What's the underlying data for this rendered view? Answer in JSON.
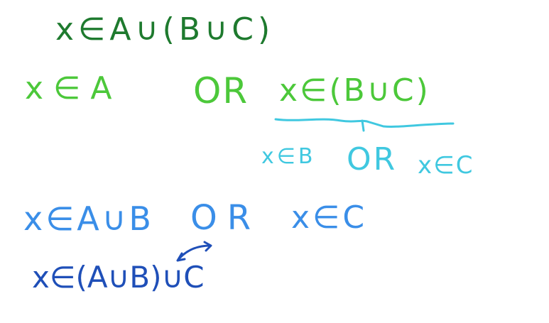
{
  "colors": {
    "dark_green": "#1e7a2e",
    "light_green": "#4cc83a",
    "cyan": "#40c8e0",
    "blue": "#3a8ee8",
    "dark_blue": "#1f4fb8",
    "background": "#ffffff"
  },
  "lines": [
    {
      "text": "x∈A∪(B∪C)",
      "color": "dark_green"
    },
    {
      "text": "x∈A",
      "color": "light_green"
    },
    {
      "text": "OR",
      "color": "light_green"
    },
    {
      "text": "x∈(B∪C)",
      "color": "light_green"
    },
    {
      "text": "x∈B",
      "color": "cyan"
    },
    {
      "text": "OR",
      "color": "cyan"
    },
    {
      "text": "x∈C",
      "color": "cyan"
    },
    {
      "text": "x∈A∪B",
      "color": "blue"
    },
    {
      "text": "OR",
      "color": "blue"
    },
    {
      "text": "x∈C",
      "color": "blue"
    },
    {
      "text": "x∈(A∪B)∪C",
      "color": "dark_blue"
    }
  ],
  "annotations": {
    "underline_color": "cyan",
    "arrow_color": "dark_blue"
  }
}
